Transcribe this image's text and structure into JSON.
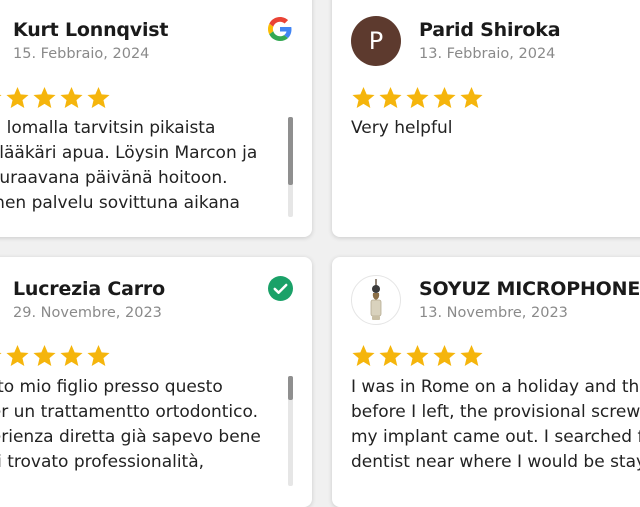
{
  "reviews": [
    {
      "name": "Kurt Lonnqvist",
      "date": "15. Febbraio, 2024",
      "rating": 5,
      "source_icon": "google-icon",
      "text_lines": [
        "an lomalla tarvitsin pikaista",
        "aslääkäri apua. Löysin Marcon ja",
        "seuraavana päivänä hoitoon.",
        "llinen palvelu sovittuna aikana"
      ]
    },
    {
      "name": "Parid Shiroka",
      "date": "13. Febbraio, 2024",
      "rating": 5,
      "avatar_letter": "P",
      "avatar_color": "#5d3a2e",
      "text_lines": [
        "Very helpful"
      ]
    },
    {
      "name": "Lucrezia Carro",
      "date": "29. Novembre, 2023",
      "rating": 5,
      "source_icon": "verified-check-icon",
      "text_lines": [
        "tato mio figlio presso questo",
        "per un trattamentto ortodontico.",
        "perienza diretta già sapevo bene",
        "rei trovato professionalità,"
      ]
    },
    {
      "name": "SOYUZ MICROPHONES",
      "date": "13. Novembre, 2023",
      "rating": 5,
      "avatar_icon": "microphone-avatar-icon",
      "text_lines": [
        "I was in Rome on a holiday and the",
        "before I left, the provisional screw fo",
        "my implant came out. I searched for",
        "dentist near where I would be stayin"
      ]
    }
  ],
  "colors": {
    "star": "#f5b50c",
    "verified": "#1aa168",
    "google_blue": "#4285f4",
    "google_red": "#ea4335",
    "google_yellow": "#fbbc05",
    "google_green": "#34a853"
  }
}
